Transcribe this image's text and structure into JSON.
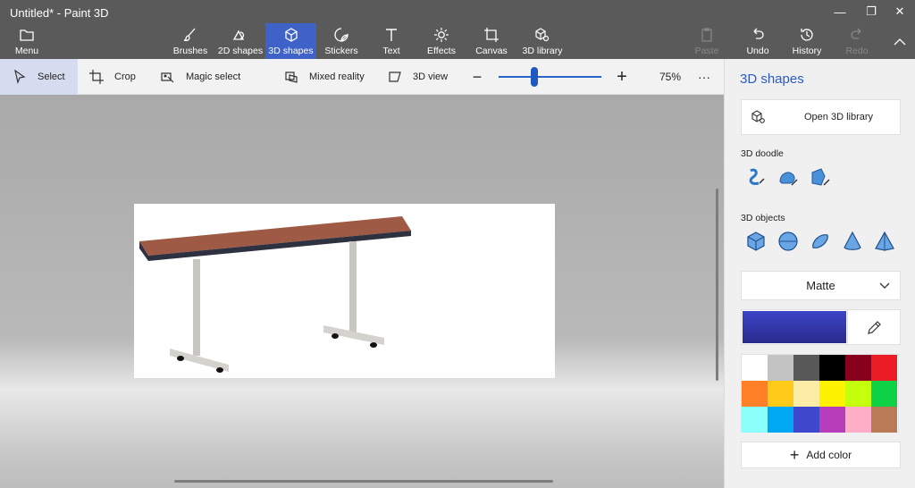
{
  "window": {
    "title": "Untitled* - Paint 3D"
  },
  "ribbon": {
    "menu": "Menu",
    "brushes": "Brushes",
    "shapes2d": "2D shapes",
    "shapes3d": "3D shapes",
    "stickers": "Stickers",
    "text": "Text",
    "effects": "Effects",
    "canvas": "Canvas",
    "library3d": "3D library",
    "paste": "Paste",
    "undo": "Undo",
    "history": "History",
    "redo": "Redo"
  },
  "toolbar": {
    "select": "Select",
    "crop": "Crop",
    "magic_select": "Magic select",
    "mixed_reality": "Mixed reality",
    "view3d": "3D view",
    "zoom": "75%",
    "zoom_level": 0.35,
    "more": "···"
  },
  "panel": {
    "title": "3D shapes",
    "open_library": "Open 3D library",
    "doodle_label": "3D doodle",
    "objects_label": "3D objects",
    "material": "Matte",
    "add_color": "Add color",
    "current_color": "#3c45c8",
    "palette": [
      "#ffffff",
      "#c3c3c3",
      "#585858",
      "#000000",
      "#88001b",
      "#ec1c24",
      "#ff7f27",
      "#ffca18",
      "#fdeca6",
      "#fff200",
      "#c4ff0e",
      "#0ed145",
      "#8cfffb",
      "#00a8f3",
      "#3f48cc",
      "#b83dba",
      "#ffaec8",
      "#b97a56"
    ]
  }
}
